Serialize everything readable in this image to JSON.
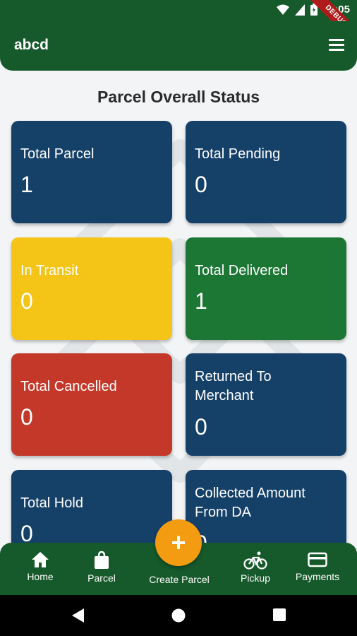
{
  "status_bar": {
    "time": "10:05",
    "ribbon": "DEBUG"
  },
  "app_bar": {
    "title": "abcd"
  },
  "page": {
    "title": "Parcel Overall Status"
  },
  "cards": [
    {
      "label": "Total Parcel",
      "value": "1",
      "color": "#154068"
    },
    {
      "label": "Total Pending",
      "value": "0",
      "color": "#154068"
    },
    {
      "label": "In Transit",
      "value": "0",
      "color": "#f4c416"
    },
    {
      "label": "Total Delivered",
      "value": "1",
      "color": "#1c7734"
    },
    {
      "label": "Total Cancelled",
      "value": "0",
      "color": "#c4382a"
    },
    {
      "label": "Returned To Merchant",
      "value": "0",
      "color": "#154068"
    },
    {
      "label": "Total Hold",
      "value": "0",
      "color": "#154068"
    },
    {
      "label": "Collected Amount From DA",
      "value": "0",
      "color": "#154068"
    }
  ],
  "bottom_nav": {
    "items": [
      {
        "label": "Home",
        "icon": "home-icon"
      },
      {
        "label": "Parcel",
        "icon": "bag-icon"
      },
      {
        "label": "Create Parcel",
        "icon": "plus-icon"
      },
      {
        "label": "Pickup",
        "icon": "bicycle-icon"
      },
      {
        "label": "Payments",
        "icon": "credit-card-icon"
      }
    ]
  },
  "colors": {
    "primary": "#165a2b",
    "accent": "#f39c12"
  }
}
